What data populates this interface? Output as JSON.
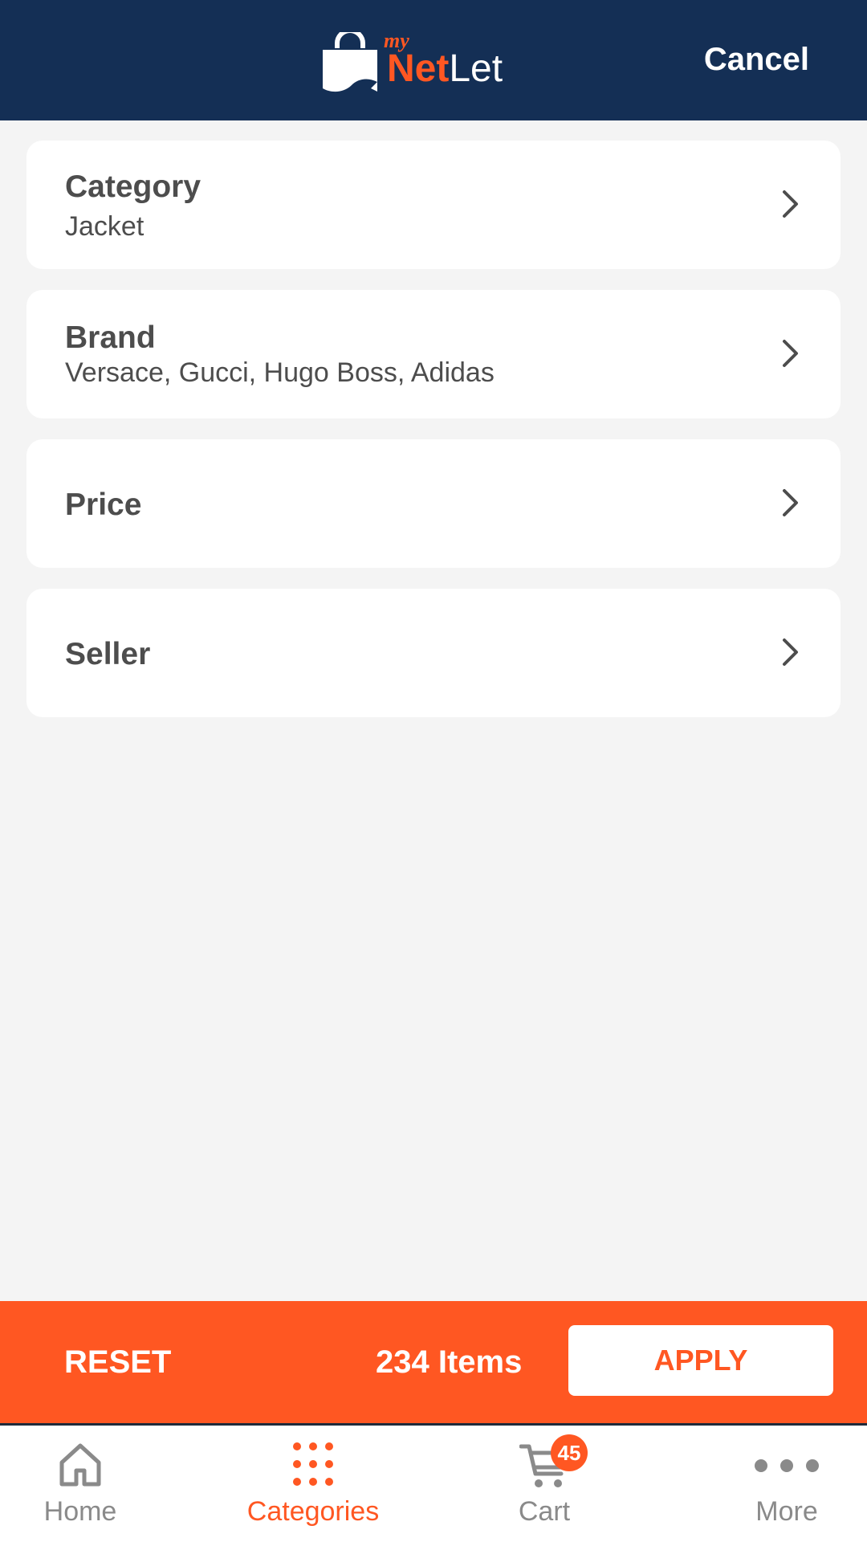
{
  "header": {
    "logo_my": "my",
    "logo_net": "Net",
    "logo_let": "Let",
    "cancel_label": "Cancel"
  },
  "filters": [
    {
      "title": "Category",
      "value": "Jacket"
    },
    {
      "title": "Brand",
      "value": "Versace, Gucci, Hugo Boss, Adidas"
    },
    {
      "title": "Price",
      "value": ""
    },
    {
      "title": "Seller",
      "value": ""
    }
  ],
  "filter_bar": {
    "reset_label": "RESET",
    "items_count": "234 Items",
    "apply_label": "APPLY"
  },
  "tabbar": {
    "home": "Home",
    "categories": "Categories",
    "cart": "Cart",
    "cart_badge": "45",
    "more": "More"
  },
  "icons": {
    "logo": "shopping-bag-icon",
    "chevron": "chevron-right-icon",
    "home": "home-icon",
    "categories": "grid-dots-icon",
    "cart": "cart-icon",
    "more": "more-dots-icon"
  },
  "colors": {
    "header_bg": "#142f55",
    "accent": "#ff5722",
    "background": "#f4f4f4",
    "text": "#4d4d4d",
    "inactive_tab": "#8a8a8a"
  }
}
